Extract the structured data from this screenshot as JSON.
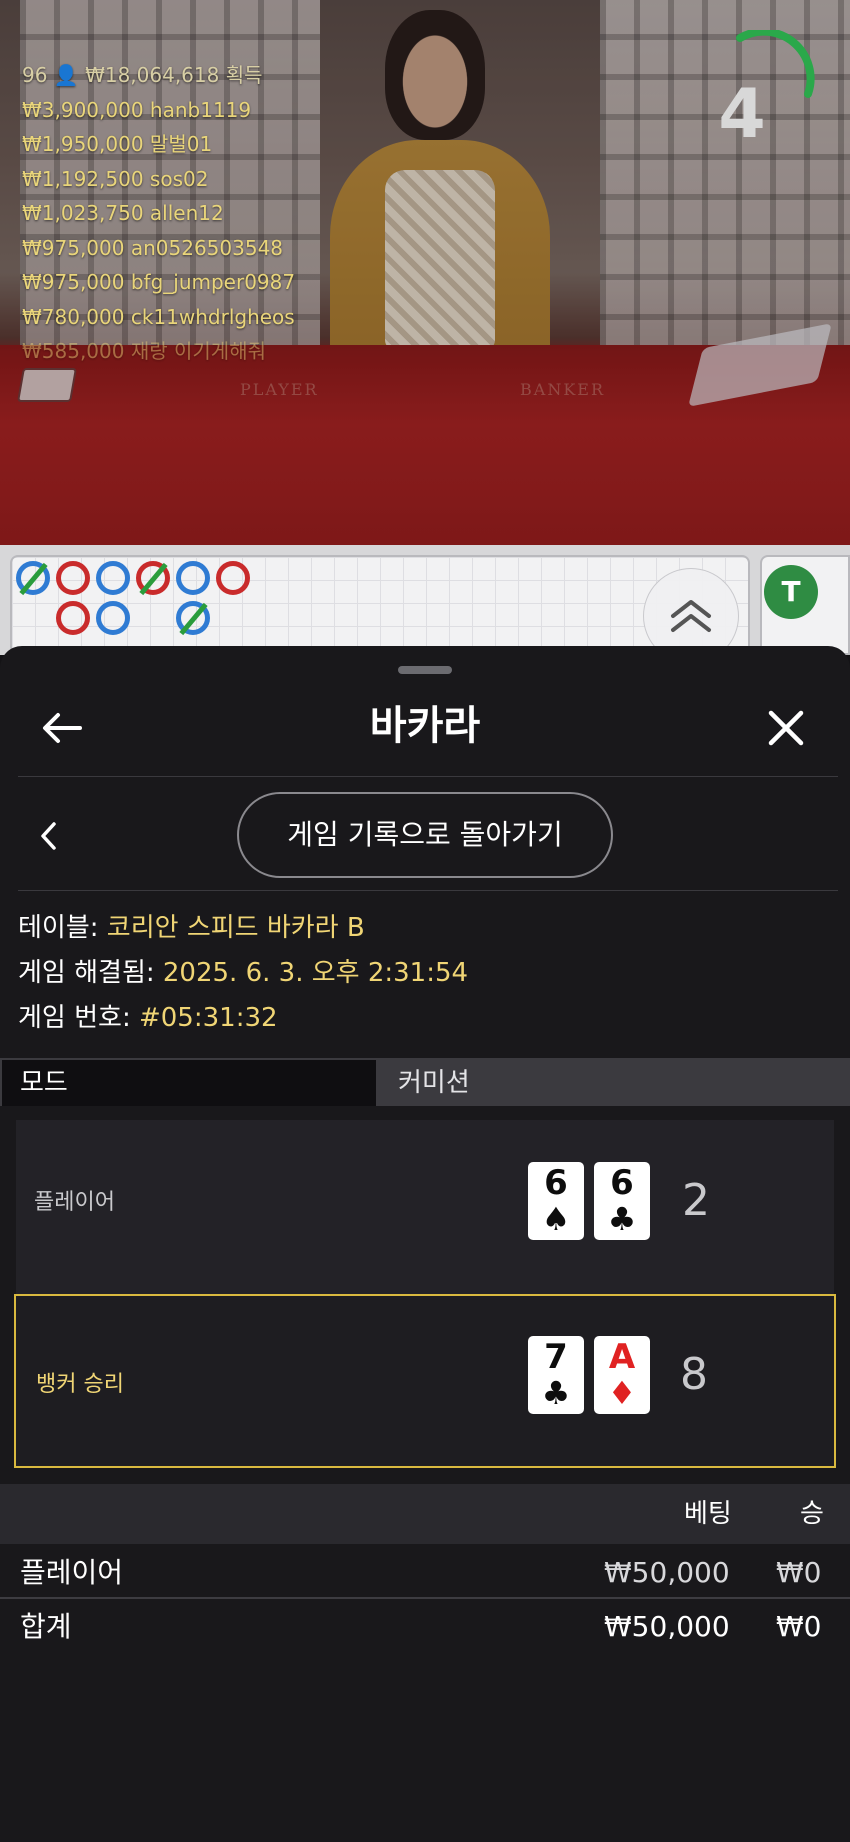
{
  "stream": {
    "felt_left": "PLAYER",
    "felt_right": "BANKER",
    "timer": "4",
    "winners_header": "96 👤 ₩18,064,618 획득",
    "winners": [
      "₩3,900,000  hanb1119",
      "₩1,950,000  말벌01",
      "₩1,192,500  sos02",
      "₩1,023,750  allen12",
      "₩975,000  an0526503548",
      "₩975,000  bfg_jumper0987",
      "₩780,000  ck11whdrlgheos",
      "₩585,000  재랑 이기게해줘"
    ]
  },
  "roads": {
    "tie_label": "T"
  },
  "sheet": {
    "title": "바카라",
    "back_to_history": "게임 기록으로 돌아가기",
    "info": {
      "table_label": "테이블:",
      "table_value": "코리안 스피드 바카라 B",
      "resolved_label": "게임 해결됨:",
      "resolved_value": "2025. 6. 3. 오후 2:31:54",
      "number_label": "게임 번호:",
      "number_value": "#05:31:32"
    },
    "tabs": [
      "모드",
      "커미션"
    ],
    "result": {
      "player": {
        "label": "플레이어",
        "score": "2",
        "cards": [
          {
            "rank": "6",
            "suit": "♠",
            "color": "black"
          },
          {
            "rank": "6",
            "suit": "♣",
            "color": "black"
          }
        ]
      },
      "banker": {
        "label": "뱅커 승리",
        "score": "8",
        "cards": [
          {
            "rank": "7",
            "suit": "♣",
            "color": "black"
          },
          {
            "rank": "A",
            "suit": "♦",
            "color": "red"
          }
        ]
      }
    },
    "bets": {
      "headers": [
        "베팅",
        "승"
      ],
      "rows": [
        {
          "name": "플레이어",
          "bet": "₩50,000",
          "win": "₩0"
        }
      ],
      "total": {
        "name": "합계",
        "bet": "₩50,000",
        "win": "₩0"
      }
    }
  },
  "colors": {
    "winner_gold": "#f0d575",
    "banker_outline": "#d9b93f",
    "banker_red": "#c92b2b",
    "player_blue": "#2f7bd3",
    "tie_green": "#2f8c43"
  }
}
